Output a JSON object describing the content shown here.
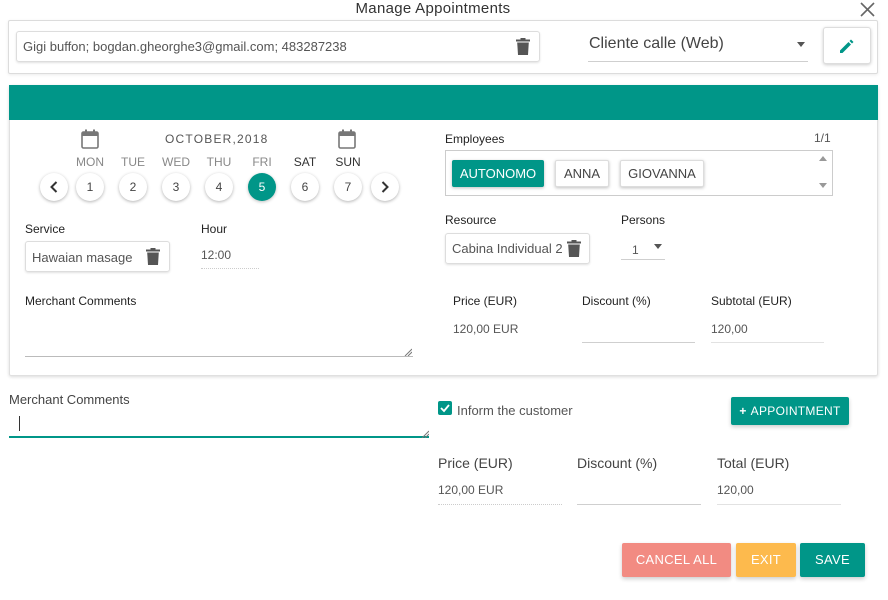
{
  "dialog": {
    "title": "Manage Appointments"
  },
  "customer": {
    "value": "Gigi buffon; bogdan.gheorghe3@gmail.com; 483287238",
    "channel": "Cliente calle (Web)"
  },
  "calendar": {
    "month_label": "OCTOBER,2018",
    "days": [
      {
        "name": "MON",
        "num": "1"
      },
      {
        "name": "TUE",
        "num": "2"
      },
      {
        "name": "WED",
        "num": "3"
      },
      {
        "name": "THU",
        "num": "4"
      },
      {
        "name": "FRI",
        "num": "5"
      },
      {
        "name": "SAT",
        "num": "6"
      },
      {
        "name": "SUN",
        "num": "7"
      }
    ],
    "selected_day": "5"
  },
  "service": {
    "label": "Service",
    "value": "Hawaian masage"
  },
  "hour": {
    "label": "Hour",
    "value": "12:00"
  },
  "employees": {
    "label": "Employees",
    "page": "1/1",
    "items": [
      "AUTONOMO",
      "ANNA",
      "GIOVANNA"
    ],
    "selected": "AUTONOMO"
  },
  "resource": {
    "label": "Resource",
    "value": "Cabina Individual 2"
  },
  "persons": {
    "label": "Persons",
    "value": "1"
  },
  "inner_comments": {
    "label": "Merchant Comments"
  },
  "inner_pricing": {
    "price_label": "Price (EUR)",
    "price_value": "120,00 EUR",
    "discount_label": "Discount (%)",
    "discount_value": "",
    "subtotal_label": "Subtotal (EUR)",
    "subtotal_value": "120,00"
  },
  "outer_comments": {
    "label": "Merchant Comments",
    "value": ""
  },
  "inform": {
    "label": "Inform the customer",
    "checked": true
  },
  "add_appointment": {
    "label": "APPOINTMENT"
  },
  "totals": {
    "price_label": "Price (EUR)",
    "price_value": "120,00 EUR",
    "discount_label": "Discount (%)",
    "discount_value": "",
    "total_label": "Total (EUR)",
    "total_value": "120,00"
  },
  "actions": {
    "cancel_all": "CANCEL ALL",
    "exit": "EXIT",
    "save": "SAVE"
  },
  "colors": {
    "accent": "#009688",
    "cancel": "#f28b82",
    "exit": "#fdba4d"
  }
}
